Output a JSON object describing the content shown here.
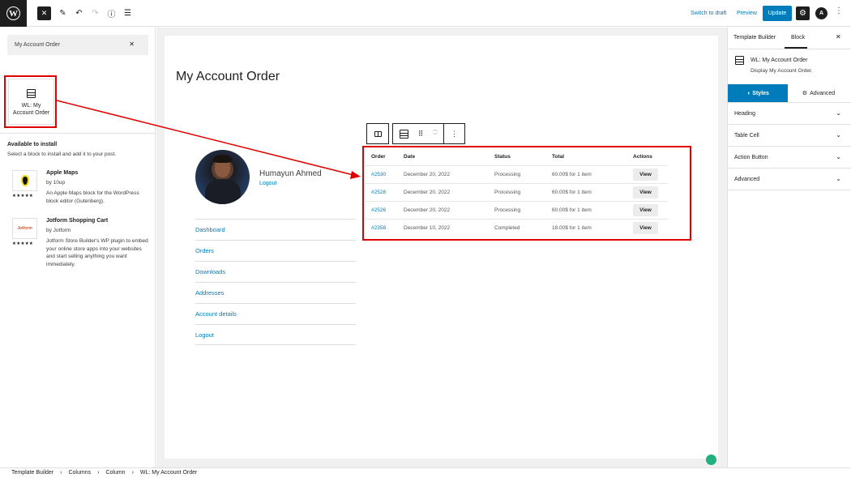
{
  "topbar": {
    "switch_to_draft": "Switch to draft",
    "preview": "Preview",
    "update": "Update"
  },
  "inserter": {
    "search_value": "My Account Order",
    "result_block_label": "WL: My Account Order",
    "available_title": "Available to install",
    "available_subtitle": "Select a block to install and add it to your post.",
    "plugins": [
      {
        "name": "Apple Maps",
        "by": "by 10up",
        "desc": "An Apple Maps block for the WordPress block editor (Gutenberg).",
        "stars": "★★★★★"
      },
      {
        "name": "Jotform Shopping Cart",
        "by": "by Jotform",
        "desc": "Jotform Store Builder's WP plugin to embed your online store apps into your websites and start selling anything you want immediately.",
        "stars": "★★★★★",
        "thumb_text": "Jotform"
      }
    ]
  },
  "canvas": {
    "page_title": "My Account Order",
    "user_name": "Humayun Ahmed",
    "user_logout": "Logout",
    "nav": [
      "Dashboard",
      "Orders",
      "Downloads",
      "Addresses",
      "Account details",
      "Logout"
    ]
  },
  "orders": {
    "headers": [
      "Order",
      "Date",
      "Status",
      "Total",
      "Actions"
    ],
    "rows": [
      {
        "order": "#2530",
        "date": "December 20, 2022",
        "status": "Processing",
        "total": "60.00$ for 1 item",
        "action": "View"
      },
      {
        "order": "#2528",
        "date": "December 20, 2022",
        "status": "Processing",
        "total": "60.00$ for 1 item",
        "action": "View"
      },
      {
        "order": "#2526",
        "date": "December 20, 2022",
        "status": "Processing",
        "total": "60.00$ for 1 item",
        "action": "View"
      },
      {
        "order": "#2358",
        "date": "December 10, 2022",
        "status": "Completed",
        "total": "18.00$ for 1 item",
        "action": "View"
      }
    ]
  },
  "sidebar": {
    "tabs": [
      "Template Builder",
      "Block"
    ],
    "block_name": "WL: My Account Order",
    "block_desc": "Display My Account Order.",
    "style_tabs": [
      "Styles",
      "Advanced"
    ],
    "panels": [
      "Heading",
      "Table Cell",
      "Action Button",
      "Advanced"
    ]
  },
  "breadcrumb": [
    "Template Builder",
    "Columns",
    "Column",
    "WL: My Account Order"
  ],
  "colors": {
    "accent": "#007cba",
    "highlight": "#e00000",
    "dark": "#1e1e1e"
  }
}
